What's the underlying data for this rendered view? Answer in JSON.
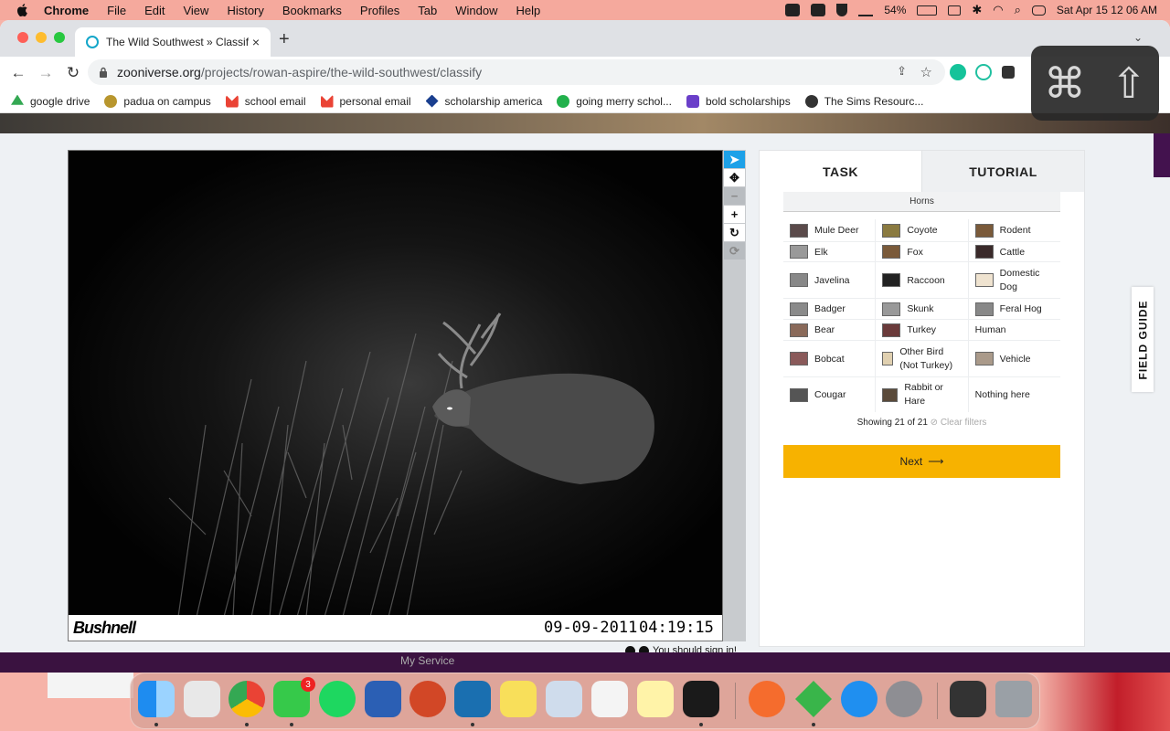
{
  "menubar": {
    "app": "Chrome",
    "items": [
      "File",
      "Edit",
      "View",
      "History",
      "Bookmarks",
      "Profiles",
      "Tab",
      "Window",
      "Help"
    ],
    "battery": "54%",
    "datetime": "Sat Apr 15  12 06 AM"
  },
  "browser": {
    "tab_title": "The Wild Southwest » Classify",
    "url_host": "zooniverse.org",
    "url_path": "/projects/rowan-aspire/the-wild-southwest/classify",
    "bookmarks": [
      {
        "label": "google drive",
        "color": "#34a853"
      },
      {
        "label": "padua on campus",
        "color": "#b8962e"
      },
      {
        "label": "school email",
        "color": "#ea4335"
      },
      {
        "label": "personal email",
        "color": "#ea4335"
      },
      {
        "label": "scholarship america",
        "color": "#1a3f8f"
      },
      {
        "label": "going merry schol...",
        "color": "#22b14c"
      },
      {
        "label": "bold scholarships",
        "color": "#6a3fc9"
      },
      {
        "label": "The Sims Resourc...",
        "color": "#333333"
      }
    ]
  },
  "viewer": {
    "brand": "Bushnell",
    "date": "09-09-2011",
    "time": "04:19:15",
    "signin": "You should sign in!"
  },
  "panel": {
    "tab_task": "TASK",
    "tab_tutorial": "TUTORIAL",
    "filter_label": "Horns",
    "species_rows": [
      [
        {
          "name": "Mule Deer",
          "thumb": "#5a4a4a"
        },
        {
          "name": "Coyote",
          "thumb": "#8a7a40"
        },
        {
          "name": "Rodent",
          "thumb": "#7a5a3a"
        }
      ],
      [
        {
          "name": "Elk",
          "thumb": "#999999"
        },
        {
          "name": "Fox",
          "thumb": "#7a5a3a"
        },
        {
          "name": "Cattle",
          "thumb": "#3a2a2a"
        }
      ],
      [
        {
          "name": "Javelina",
          "thumb": "#888888"
        },
        {
          "name": "Raccoon",
          "thumb": "#222222"
        },
        {
          "name": "Domestic Dog",
          "thumb": "#efe3d0"
        }
      ],
      [
        {
          "name": "Badger",
          "thumb": "#8a8a8a"
        },
        {
          "name": "Skunk",
          "thumb": "#999999"
        },
        {
          "name": "Feral Hog",
          "thumb": "#888888"
        }
      ],
      [
        {
          "name": "Bear",
          "thumb": "#8a6a5a"
        },
        {
          "name": "Turkey",
          "thumb": "#6a3a3a"
        },
        {
          "name": "Human",
          "thumb": ""
        }
      ],
      [
        {
          "name": "Bobcat",
          "thumb": "#8a5a5a"
        },
        {
          "name": "Other Bird (Not Turkey)",
          "thumb": "#e0d0b0"
        },
        {
          "name": "Vehicle",
          "thumb": "#aa9a8a"
        }
      ],
      [
        {
          "name": "Cougar",
          "thumb": "#555555"
        },
        {
          "name": "Rabbit or Hare",
          "thumb": "#5a4a3a"
        },
        {
          "name": "Nothing here",
          "thumb": ""
        }
      ]
    ],
    "showing": "Showing 21 of 21",
    "clear_filters": "Clear filters",
    "next": "Next",
    "field_guide": "FIELD GUIDE"
  },
  "desktop": {
    "service_text": "My Service",
    "messages_badge": "3"
  },
  "colors": {
    "accent": "#f7b200",
    "tool_active": "#1da1e8",
    "menubar": "#f5a99d"
  }
}
